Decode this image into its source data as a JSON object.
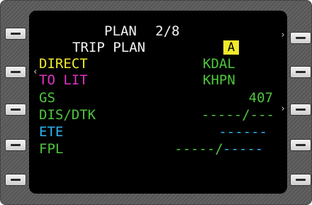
{
  "header": {
    "title": "PLAN",
    "page": "2/8"
  },
  "subheader": {
    "title": "TRIP PLAN",
    "mode_badge": "A"
  },
  "rows": {
    "direct": {
      "label": "DIRECT",
      "value": "KDAL"
    },
    "to": {
      "label": "TO LIT",
      "value": "KHPN"
    },
    "gs": {
      "label": "GS",
      "value": "407"
    },
    "dis_dtk": {
      "label": "DIS/DTK",
      "value": "-----/---"
    },
    "ete": {
      "label": "ETE",
      "value": "------"
    },
    "fpl": {
      "label": "FPL",
      "value_a": "-----/",
      "value_b": "-----"
    }
  },
  "carets": {
    "left": "‹",
    "right": "›"
  },
  "colors": {
    "white": "#f4f4f4",
    "yellow": "#f2ea2a",
    "magenta": "#e032c8",
    "green": "#4fc63d",
    "cyan": "#27b7f2"
  }
}
